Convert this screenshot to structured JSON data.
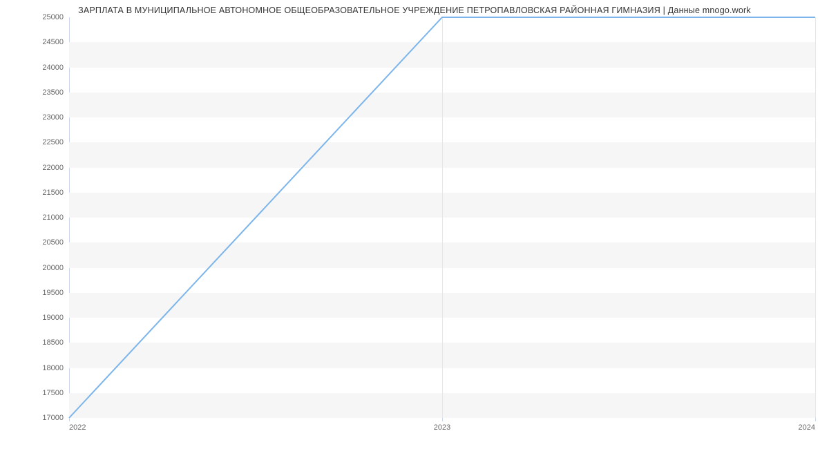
{
  "chart_data": {
    "type": "line",
    "title": "ЗАРПЛАТА В МУНИЦИПАЛЬНОЕ АВТОНОМНОЕ ОБЩЕОБРАЗОВАТЕЛЬНОЕ УЧРЕЖДЕНИЕ ПЕТРОПАВЛОВСКАЯ РАЙОННАЯ ГИМНАЗИЯ | Данные mnogo.work",
    "x": [
      2022,
      2023,
      2024
    ],
    "values": [
      17000,
      25000,
      25000
    ],
    "xlabel": "",
    "ylabel": "",
    "ylim": [
      17000,
      25000
    ],
    "y_ticks": [
      17000,
      17500,
      18000,
      18500,
      19000,
      19500,
      20000,
      20500,
      21000,
      21500,
      22000,
      22500,
      23000,
      23500,
      24000,
      24500,
      25000
    ],
    "x_ticks": [
      2022,
      2023,
      2024
    ],
    "colors": {
      "line": "#7cb5ec",
      "band": "#f6f6f6"
    }
  }
}
